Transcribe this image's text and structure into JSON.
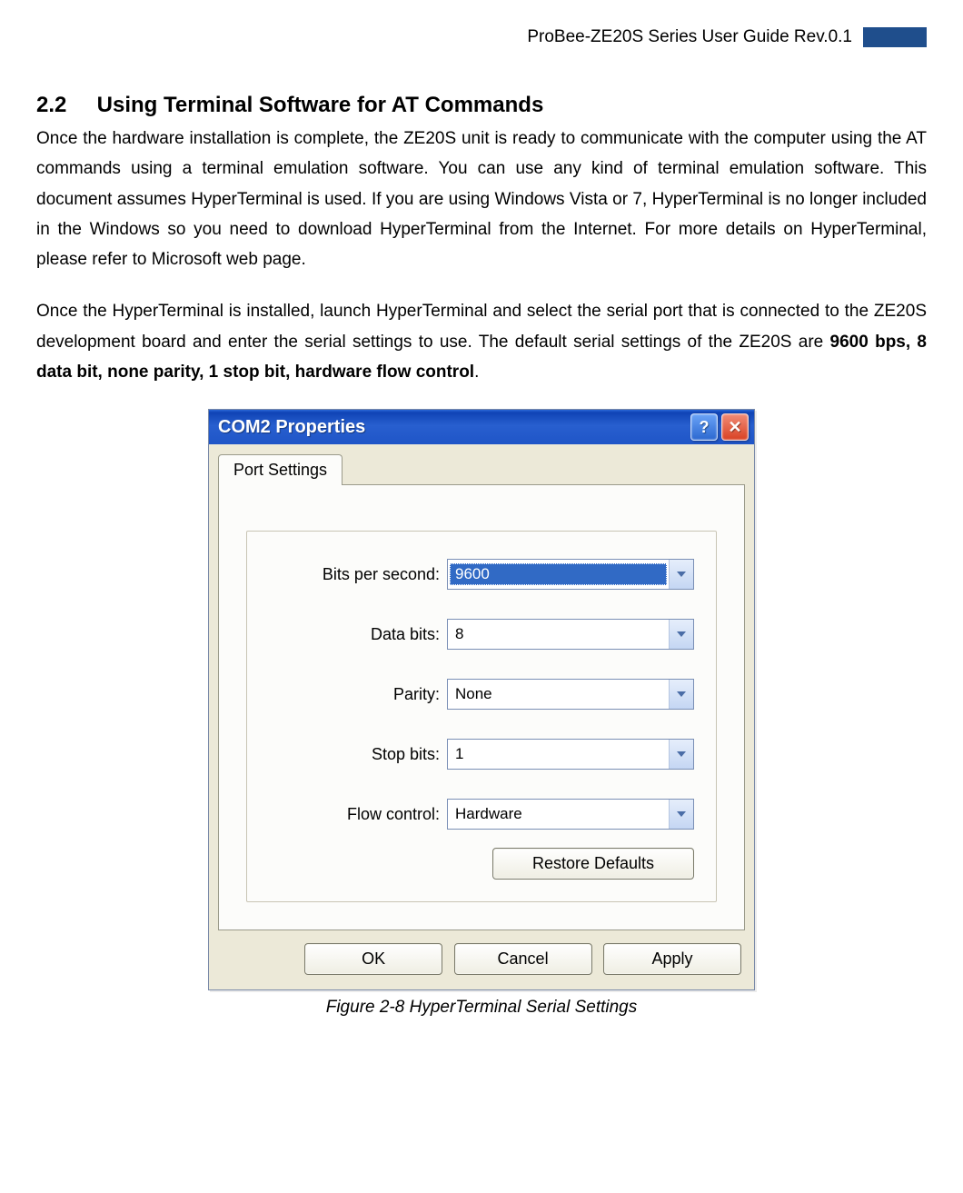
{
  "header": {
    "doc_title": "ProBee-ZE20S Series User Guide Rev.0.1"
  },
  "section": {
    "number": "2.2",
    "title": "Using Terminal Software for AT Commands",
    "para1": "Once the hardware installation is complete, the ZE20S unit is ready to communicate with the computer using the AT commands using a terminal emulation software. You can use any kind of terminal emulation software. This document assumes HyperTerminal is used. If you are using Windows Vista or 7, HyperTerminal is no longer included in the Windows so you need to download HyperTerminal from the Internet. For more details on HyperTerminal, please refer to Microsoft web page.",
    "para2_a": "Once the HyperTerminal is installed, launch HyperTerminal and select the serial port that is connected to the ZE20S development board and enter the serial settings to use. The default serial settings of the ZE20S are ",
    "para2_bold": "9600 bps, 8 data bit, none parity, 1 stop bit, hardware flow control",
    "para2_b": "."
  },
  "dialog": {
    "title": "COM2 Properties",
    "help_icon": "?",
    "close_icon": "✕",
    "tab_label": "Port Settings",
    "fields": {
      "bps": {
        "label": "Bits per second:",
        "value": "9600"
      },
      "databits": {
        "label": "Data bits:",
        "value": "8"
      },
      "parity": {
        "label": "Parity:",
        "value": "None"
      },
      "stopbits": {
        "label": "Stop bits:",
        "value": "1"
      },
      "flow": {
        "label": "Flow control:",
        "value": "Hardware"
      }
    },
    "restore_label": "Restore Defaults",
    "ok_label": "OK",
    "cancel_label": "Cancel",
    "apply_label": "Apply"
  },
  "figure_caption": "Figure 2-8 HyperTerminal Serial Settings"
}
